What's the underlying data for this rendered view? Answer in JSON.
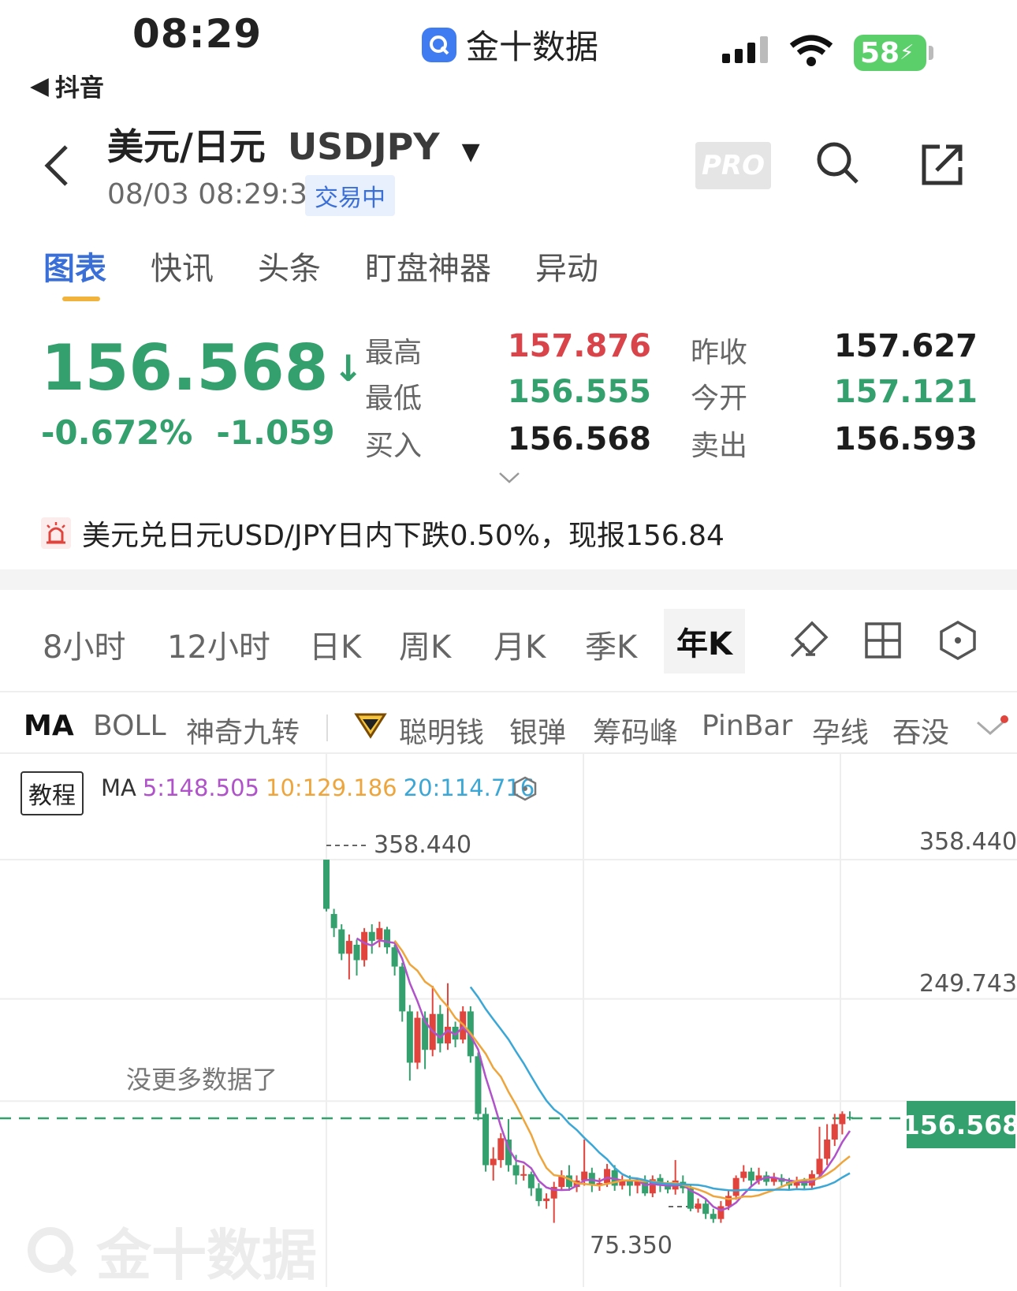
{
  "status": {
    "time": "08:29",
    "back_app": "抖音",
    "app_name": "金十数据",
    "battery": "58"
  },
  "header": {
    "title_cn": "美元/日元",
    "title_code": "USDJPY",
    "datetime": "08/03 08:29:33",
    "trade_status": "交易中",
    "pro_label": "PRO"
  },
  "tabs": [
    {
      "label": "图表"
    },
    {
      "label": "快讯"
    },
    {
      "label": "头条"
    },
    {
      "label": "盯盘神器"
    },
    {
      "label": "异动"
    }
  ],
  "quote": {
    "price": "156.568",
    "arrow": "↓",
    "pct": "-0.672%",
    "change": "-1.059",
    "high_label": "最高",
    "high": "157.876",
    "prev_close_label": "昨收",
    "prev_close": "157.627",
    "low_label": "最低",
    "low": "156.555",
    "open_label": "今开",
    "open": "157.121",
    "bid_label": "买入",
    "bid": "156.568",
    "ask_label": "卖出",
    "ask": "156.593"
  },
  "news": {
    "text": "美元兑日元USD/JPY日内下跌0.50%，现报156.84"
  },
  "periods": [
    {
      "label": "8小时"
    },
    {
      "label": "12小时"
    },
    {
      "label": "日K"
    },
    {
      "label": "周K"
    },
    {
      "label": "月K"
    },
    {
      "label": "季K"
    },
    {
      "label": "年K"
    }
  ],
  "indicators": [
    {
      "label": "MA"
    },
    {
      "label": "BOLL"
    },
    {
      "label": "神奇九转"
    },
    {
      "label": "聪明钱"
    },
    {
      "label": "银弹"
    },
    {
      "label": "筹码峰"
    },
    {
      "label": "PinBar"
    },
    {
      "label": "孕线"
    },
    {
      "label": "吞没"
    }
  ],
  "chart_header": {
    "tutorial": "教程",
    "ma_label": "MA",
    "ma5": "5:148.505",
    "ma10": "10:129.186",
    "ma20": "20:114.716",
    "ma5_color": "#b052c9",
    "ma10_color": "#eea53c",
    "ma20_color": "#3aa7d6"
  },
  "chart_labels": {
    "y_top": "358.440",
    "y_mid": "249.743",
    "last_price": "156.568",
    "high_marker": "358.440",
    "low_marker": "75.350",
    "no_more": "没更多数据了",
    "watermark": "金十数据"
  },
  "chart_data": {
    "type": "candlestick",
    "ylim": [
      60,
      380
    ],
    "reference_lines": [
      358.44,
      249.743,
      156.568
    ],
    "candles": [
      {
        "o": 358.4,
        "c": 320,
        "h": 358.4,
        "l": 318
      },
      {
        "o": 316,
        "c": 305,
        "h": 320,
        "l": 298
      },
      {
        "o": 304,
        "c": 285,
        "h": 308,
        "l": 280
      },
      {
        "o": 285,
        "c": 295,
        "h": 300,
        "l": 265
      },
      {
        "o": 292,
        "c": 280,
        "h": 296,
        "l": 268
      },
      {
        "o": 280,
        "c": 302,
        "h": 305,
        "l": 275
      },
      {
        "o": 302,
        "c": 295,
        "h": 308,
        "l": 285
      },
      {
        "o": 296,
        "c": 305,
        "h": 310,
        "l": 290
      },
      {
        "o": 304,
        "c": 290,
        "h": 306,
        "l": 285
      },
      {
        "o": 290,
        "c": 275,
        "h": 292,
        "l": 268
      },
      {
        "o": 275,
        "c": 240,
        "h": 278,
        "l": 232
      },
      {
        "o": 240,
        "c": 200,
        "h": 245,
        "l": 186
      },
      {
        "o": 200,
        "c": 235,
        "h": 240,
        "l": 195
      },
      {
        "o": 235,
        "c": 210,
        "h": 240,
        "l": 195
      },
      {
        "o": 210,
        "c": 238,
        "h": 260,
        "l": 205
      },
      {
        "o": 238,
        "c": 215,
        "h": 245,
        "l": 208
      },
      {
        "o": 215,
        "c": 228,
        "h": 262,
        "l": 210
      },
      {
        "o": 228,
        "c": 218,
        "h": 232,
        "l": 212
      },
      {
        "o": 218,
        "c": 240,
        "h": 244,
        "l": 215
      },
      {
        "o": 240,
        "c": 205,
        "h": 244,
        "l": 200
      },
      {
        "o": 205,
        "c": 160,
        "h": 208,
        "l": 155
      },
      {
        "o": 160,
        "c": 120,
        "h": 165,
        "l": 115
      },
      {
        "o": 120,
        "c": 125,
        "h": 134,
        "l": 108
      },
      {
        "o": 124,
        "c": 141,
        "h": 145,
        "l": 118
      },
      {
        "o": 140,
        "c": 120,
        "h": 156,
        "l": 115
      },
      {
        "o": 120,
        "c": 112,
        "h": 128,
        "l": 105
      },
      {
        "o": 112,
        "c": 113,
        "h": 120,
        "l": 108
      },
      {
        "o": 113,
        "c": 102,
        "h": 115,
        "l": 96
      },
      {
        "o": 102,
        "c": 92,
        "h": 106,
        "l": 88
      },
      {
        "o": 92,
        "c": 94,
        "h": 98,
        "l": 86
      },
      {
        "o": 94,
        "c": 103,
        "h": 107,
        "l": 75
      },
      {
        "o": 103,
        "c": 112,
        "h": 116,
        "l": 100
      },
      {
        "o": 112,
        "c": 103,
        "h": 120,
        "l": 100
      },
      {
        "o": 103,
        "c": 108,
        "h": 112,
        "l": 99
      },
      {
        "o": 108,
        "c": 115,
        "h": 140,
        "l": 104
      },
      {
        "o": 114,
        "c": 105,
        "h": 118,
        "l": 99
      },
      {
        "o": 105,
        "c": 106,
        "h": 110,
        "l": 100
      },
      {
        "o": 106,
        "c": 117,
        "h": 121,
        "l": 103
      },
      {
        "o": 116,
        "c": 104,
        "h": 120,
        "l": 100
      },
      {
        "o": 104,
        "c": 108,
        "h": 112,
        "l": 101
      },
      {
        "o": 108,
        "c": 104,
        "h": 112,
        "l": 96
      },
      {
        "o": 104,
        "c": 108,
        "h": 110,
        "l": 98
      },
      {
        "o": 108,
        "c": 98,
        "h": 112,
        "l": 96
      },
      {
        "o": 98,
        "c": 109,
        "h": 112,
        "l": 95
      },
      {
        "o": 110,
        "c": 104,
        "h": 113,
        "l": 99
      },
      {
        "o": 104,
        "c": 101,
        "h": 108,
        "l": 98
      },
      {
        "o": 101,
        "c": 108,
        "h": 124,
        "l": 97
      },
      {
        "o": 107,
        "c": 102,
        "h": 112,
        "l": 98
      },
      {
        "o": 102,
        "c": 86,
        "h": 104,
        "l": 84
      },
      {
        "o": 86,
        "c": 90,
        "h": 94,
        "l": 83
      },
      {
        "o": 90,
        "c": 82,
        "h": 93,
        "l": 78
      },
      {
        "o": 82,
        "c": 78,
        "h": 86,
        "l": 75
      },
      {
        "o": 78,
        "c": 88,
        "h": 92,
        "l": 75
      },
      {
        "o": 88,
        "c": 96,
        "h": 100,
        "l": 85
      },
      {
        "o": 96,
        "c": 110,
        "h": 112,
        "l": 93
      },
      {
        "o": 110,
        "c": 115,
        "h": 120,
        "l": 107
      },
      {
        "o": 115,
        "c": 108,
        "h": 118,
        "l": 104
      },
      {
        "o": 108,
        "c": 112,
        "h": 118,
        "l": 105
      },
      {
        "o": 112,
        "c": 107,
        "h": 115,
        "l": 104
      },
      {
        "o": 107,
        "c": 110,
        "h": 114,
        "l": 104
      },
      {
        "o": 110,
        "c": 107,
        "h": 113,
        "l": 104
      },
      {
        "o": 107,
        "c": 104,
        "h": 110,
        "l": 101
      },
      {
        "o": 104,
        "c": 108,
        "h": 111,
        "l": 102
      },
      {
        "o": 108,
        "c": 104,
        "h": 110,
        "l": 101
      },
      {
        "o": 104,
        "c": 113,
        "h": 116,
        "l": 102
      },
      {
        "o": 113,
        "c": 125,
        "h": 150,
        "l": 110
      },
      {
        "o": 125,
        "c": 140,
        "h": 152,
        "l": 120
      },
      {
        "o": 140,
        "c": 152,
        "h": 160,
        "l": 135
      },
      {
        "o": 152,
        "c": 160,
        "h": 162,
        "l": 144
      },
      {
        "o": 157.6,
        "c": 156.6,
        "h": 162,
        "l": 155
      }
    ]
  }
}
